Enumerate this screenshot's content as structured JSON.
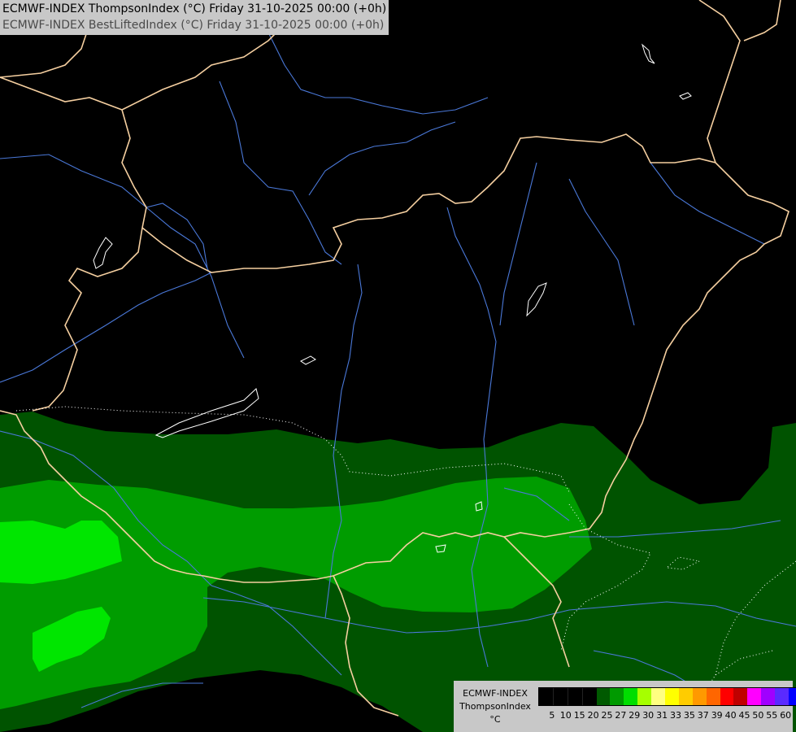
{
  "header": {
    "line1": "ECMWF-INDEX ThompsonIndex (°C) Friday 31-10-2025 00:00 (+0h)",
    "line2": "ECMWF-INDEX BestLiftedIndex (°C) Friday 31-10-2025 00:00 (+0h)"
  },
  "legend": {
    "model": "ECMWF-INDEX",
    "parameter": "ThompsonIndex",
    "unit": "°C",
    "ticks": [
      "5",
      "10",
      "15",
      "20",
      "25",
      "27",
      "29",
      "30",
      "31",
      "33",
      "35",
      "37",
      "39",
      "40",
      "45",
      "50",
      "55",
      "60"
    ],
    "colors": [
      "#000000",
      "#000000",
      "#000000",
      "#000000",
      "#005a00",
      "#009a00",
      "#00de00",
      "#a6ff00",
      "#ffff80",
      "#ffff00",
      "#ffcc00",
      "#ff9900",
      "#ff6600",
      "#ff0000",
      "#c00000",
      "#ff00ff",
      "#a000ff",
      "#5a2aff",
      "#0000ff"
    ]
  },
  "map_colors": {
    "background": "#000000",
    "band_dark": "#005300",
    "band_mid": "#009c00",
    "band_light": "#00e600",
    "border": "#f5cfa0",
    "river": "#4a78d8",
    "lake": "#ffffff"
  }
}
